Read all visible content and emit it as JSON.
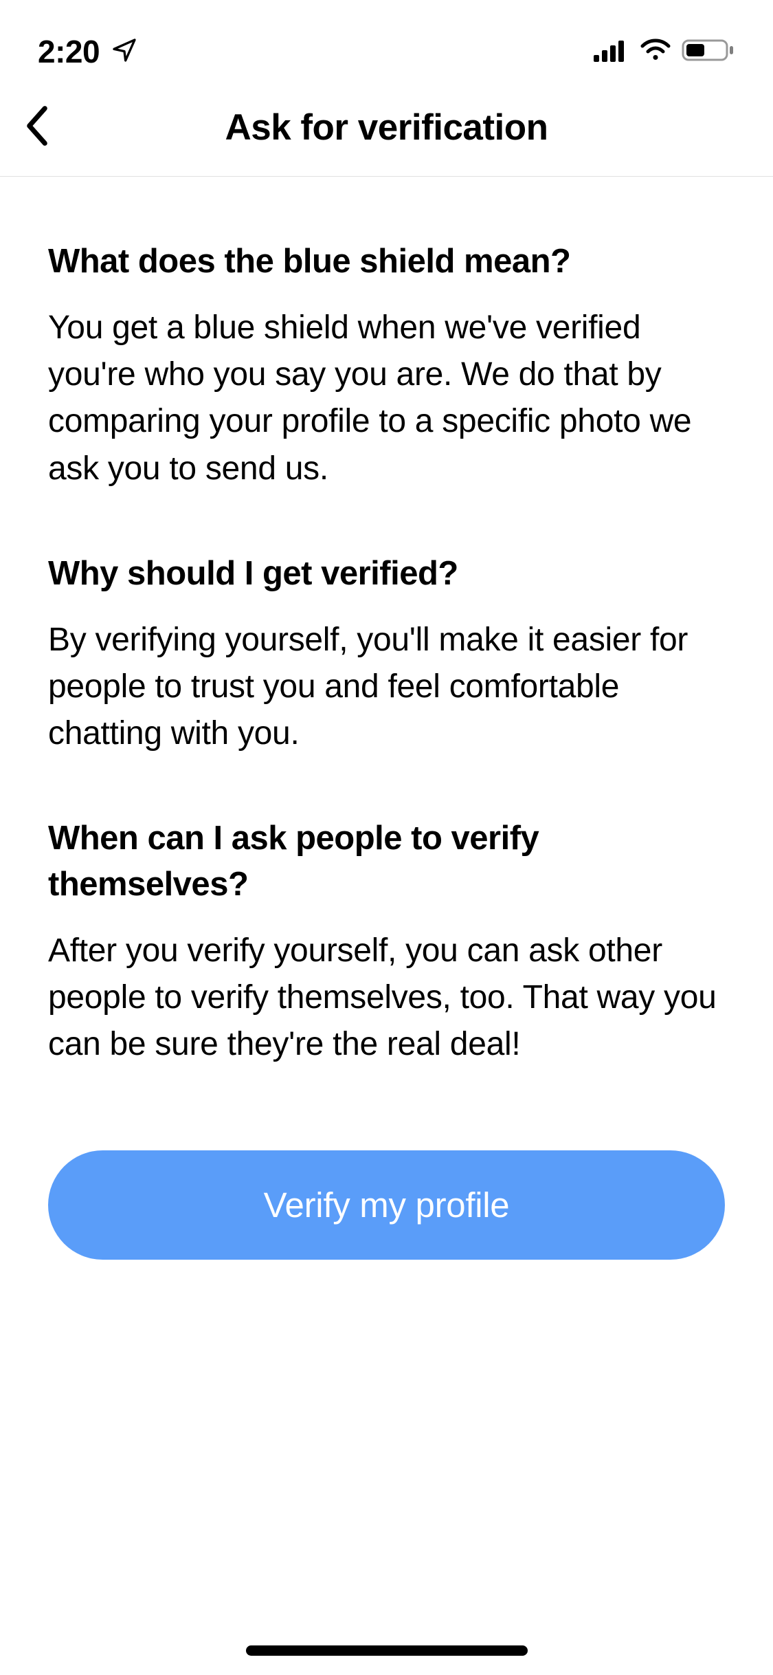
{
  "statusBar": {
    "time": "2:20"
  },
  "header": {
    "title": "Ask for verification"
  },
  "sections": [
    {
      "heading": "What does the blue shield mean?",
      "body": "You get a blue shield when we've verified you're who you say you are. We do that by comparing your profile to a specific photo we ask you to send us."
    },
    {
      "heading": "Why should I get verified?",
      "body": "By verifying yourself, you'll make it easier for people to trust you and feel comfortable chatting with you."
    },
    {
      "heading": "When can I ask people to verify themselves?",
      "body": "After you verify yourself, you can ask other people to verify themselves, too. That way you can be sure they're the real deal!"
    }
  ],
  "cta": {
    "label": "Verify my profile"
  }
}
